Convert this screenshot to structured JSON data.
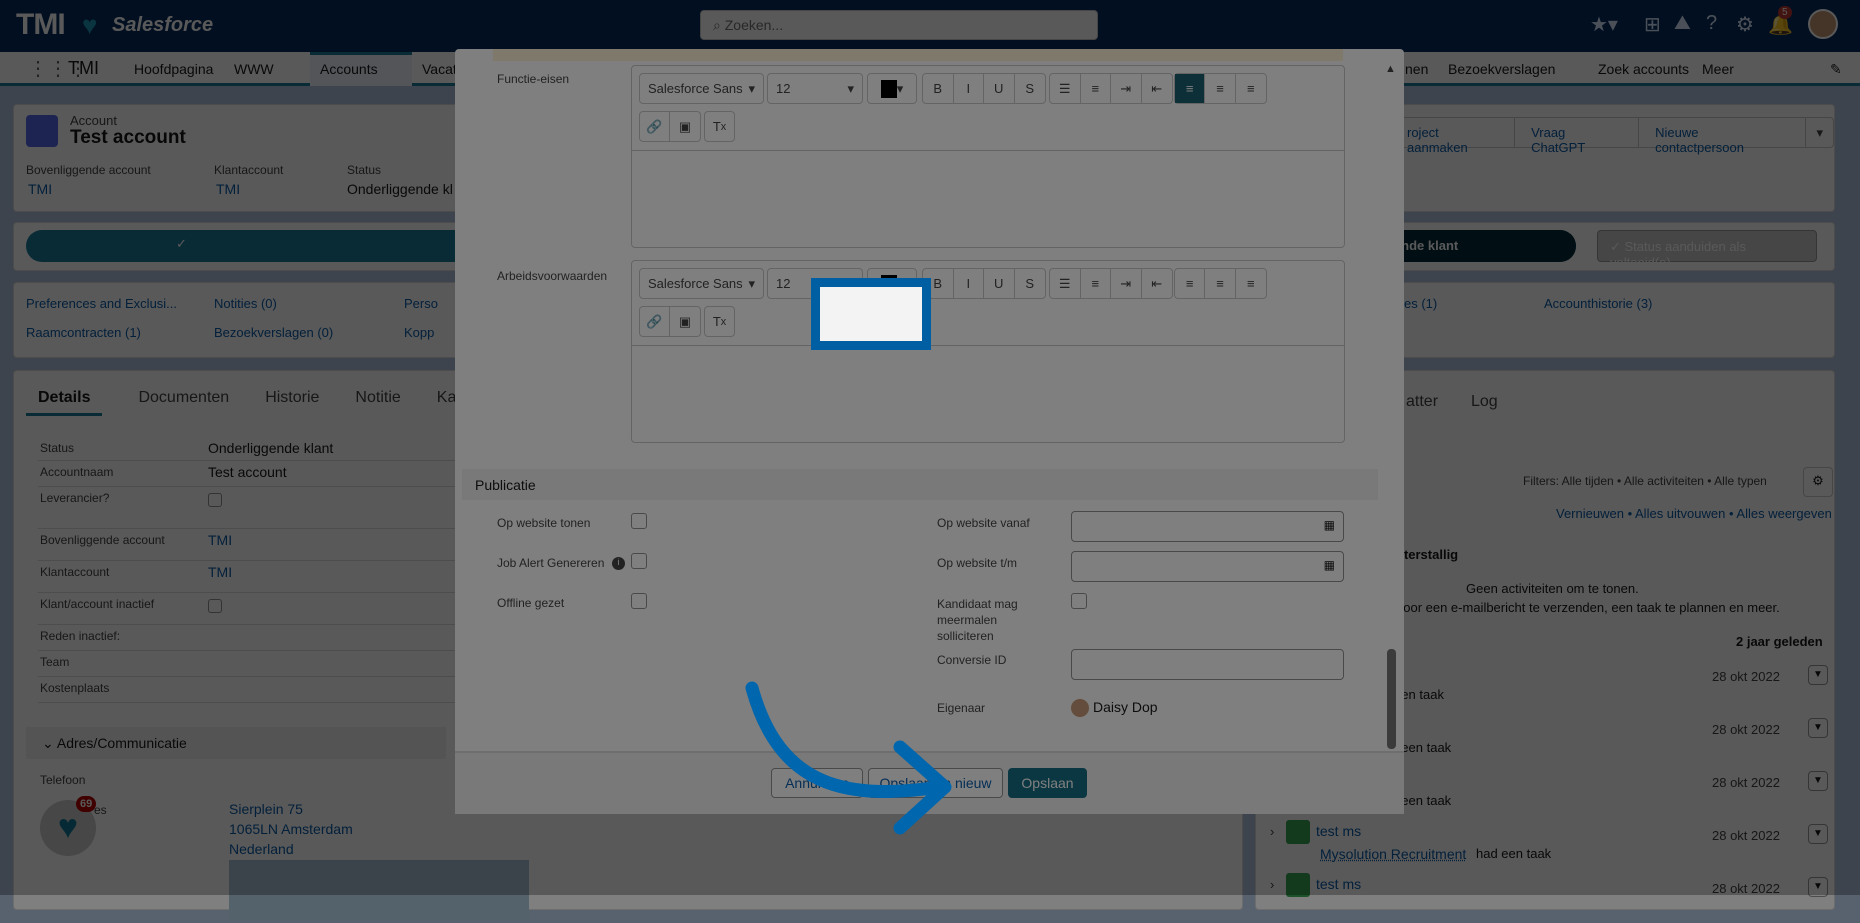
{
  "header": {
    "logo": "TMI",
    "brand": "Salesforce",
    "search_placeholder": "Zoeken...",
    "notification_count": "5"
  },
  "nav": {
    "app": "TMI",
    "items": [
      "Hoofdpagina",
      "WWW",
      "Accounts",
      "Vacat",
      "nen",
      "Bezoekverslagen",
      "Zoek accounts",
      "Meer"
    ]
  },
  "account": {
    "type": "Account",
    "name": "Test account",
    "fields": [
      {
        "label": "Bovenliggende account",
        "value": "TMI"
      },
      {
        "label": "Klantaccount",
        "value": "TMI"
      },
      {
        "label": "Status",
        "value": "Onderliggende kl"
      }
    ],
    "actions": [
      "roject aanmaken",
      "Vraag ChatGPT",
      "Nieuwe contactpersoon"
    ]
  },
  "path": {
    "current": "gende klant",
    "complete_button": "Status aanduiden als voltooid(e)"
  },
  "related": [
    "Preferences and Exclusi...",
    "Notities (0)",
    "Perso",
    "Raamcontracten (1)",
    "Bezoekverslagen (0)",
    "Kopp",
    "es (1)",
    "Accounthistorie (3)"
  ],
  "tabs": [
    "Details",
    "Documenten",
    "Historie",
    "Notitie",
    "Kan"
  ],
  "details": [
    {
      "label": "Status",
      "value": "Onderliggende klant"
    },
    {
      "label": "Accountnaam",
      "value": "Test account"
    },
    {
      "label": "Leverancier?",
      "value": ""
    },
    {
      "label": "Bovenliggende account",
      "value": "TMI"
    },
    {
      "label": "Klantaccount",
      "value": "TMI"
    },
    {
      "label": "Klant/account inactief",
      "value": ""
    },
    {
      "label": "Reden inactief:",
      "value": ""
    },
    {
      "label": "Team",
      "value": ""
    },
    {
      "label": "Kostenplaats",
      "value": ""
    }
  ],
  "address_section": "Adres/Communicatie",
  "phone_label": "Telefoon",
  "address_label": "es",
  "address": [
    "Sierplein 75",
    "1065LN Amsterdam",
    "Nederland"
  ],
  "fab_badge": "69",
  "activity": {
    "tabs": [
      "atter",
      "Log"
    ],
    "filters": "Filters: Alle tijden • Alle activiteiten • Alle typen",
    "links": [
      "Vernieuwen",
      "Alles uitvouwen",
      "Alles weergeven"
    ],
    "overdue": "nterstallig",
    "empty1": "Geen activiteiten om te tonen.",
    "empty2": "door een e-mailbericht te verzenden, een taak te plannen en meer.",
    "period": "2 jaar geleden",
    "items": [
      {
        "title": "",
        "who": "",
        "text": "ad een taak",
        "date": "28 okt 2022"
      },
      {
        "title": "",
        "who": "",
        "text": "had een taak",
        "date": "28 okt 2022"
      },
      {
        "title": "",
        "who": "eijer",
        "text": "had een taak",
        "date": "28 okt 2022"
      },
      {
        "title": "test ms",
        "who": "Mysolution Recruitment",
        "text": "had een taak",
        "date": "28 okt 2022"
      },
      {
        "title": "test ms",
        "who": "",
        "text": "",
        "date": "28 okt 2022"
      }
    ]
  },
  "modal": {
    "field1": "Functie-eisen",
    "field2": "Arbeidsvoorwaarden",
    "font": "Salesforce Sans",
    "size": "12",
    "section": "Publicatie",
    "left": [
      "Op website tonen",
      "Job Alert Genereren",
      "Offline gezet"
    ],
    "right": [
      "Op website vanaf",
      "Op website t/m",
      "Kandidaat mag meermalen solliciteren",
      "Conversie ID",
      "Eigenaar"
    ],
    "owner": "Daisy Dop",
    "buttons": {
      "cancel": "Annuleren",
      "save_new": "Opslaan en nieuw",
      "save": "Opslaan"
    }
  },
  "colors": {
    "header": "#032d60",
    "accent": "#1b7d9c",
    "highlight": "#005fa3"
  }
}
